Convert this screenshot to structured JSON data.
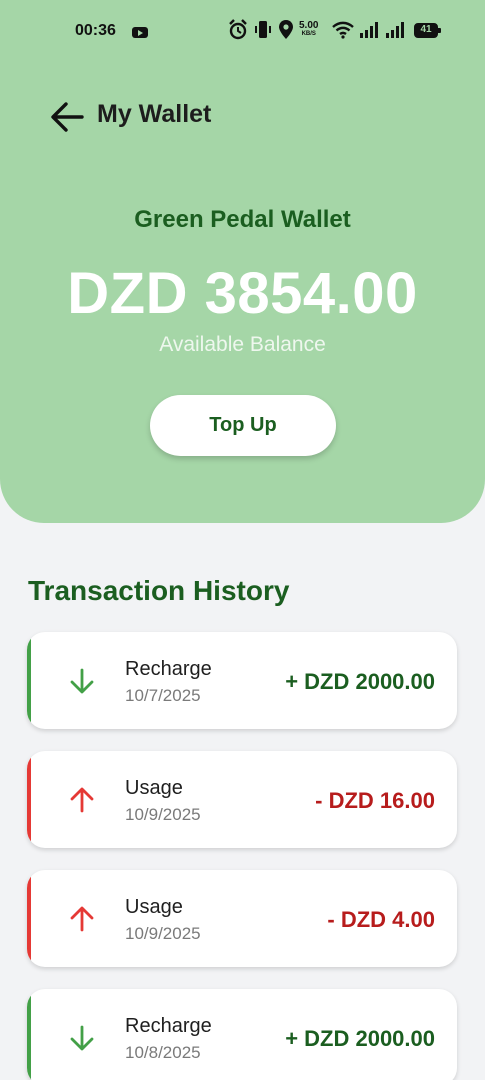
{
  "status_bar": {
    "time": "00:36",
    "net_speed": "5.00",
    "net_speed_unit": "KB/S",
    "battery": "41"
  },
  "top_bar": {
    "title": "My Wallet",
    "back_icon": "arrow-left-icon"
  },
  "wallet": {
    "name": "Green Pedal Wallet",
    "balance": "DZD 3854.00",
    "balance_label": "Available Balance",
    "topup_label": "Top Up"
  },
  "history": {
    "title": "Transaction History",
    "items": [
      {
        "type": "Recharge",
        "date": "10/7/2025",
        "amount": "+ DZD 2000.00",
        "direction": "in",
        "icon": "arrow-down-icon"
      },
      {
        "type": "Usage",
        "date": "10/9/2025",
        "amount": "- DZD 16.00",
        "direction": "out",
        "icon": "arrow-up-icon"
      },
      {
        "type": "Usage",
        "date": "10/9/2025",
        "amount": "- DZD 4.00",
        "direction": "out",
        "icon": "arrow-up-icon"
      },
      {
        "type": "Recharge",
        "date": "10/8/2025",
        "amount": "+ DZD 2000.00",
        "direction": "in",
        "icon": "arrow-down-icon"
      }
    ]
  },
  "colors": {
    "header_bg": "#a5d6a7",
    "primary_dark": "#1b5e20",
    "credit": "#43a047",
    "debit": "#e53935",
    "credit_text": "#1b5e20",
    "debit_text": "#b71c1c"
  }
}
